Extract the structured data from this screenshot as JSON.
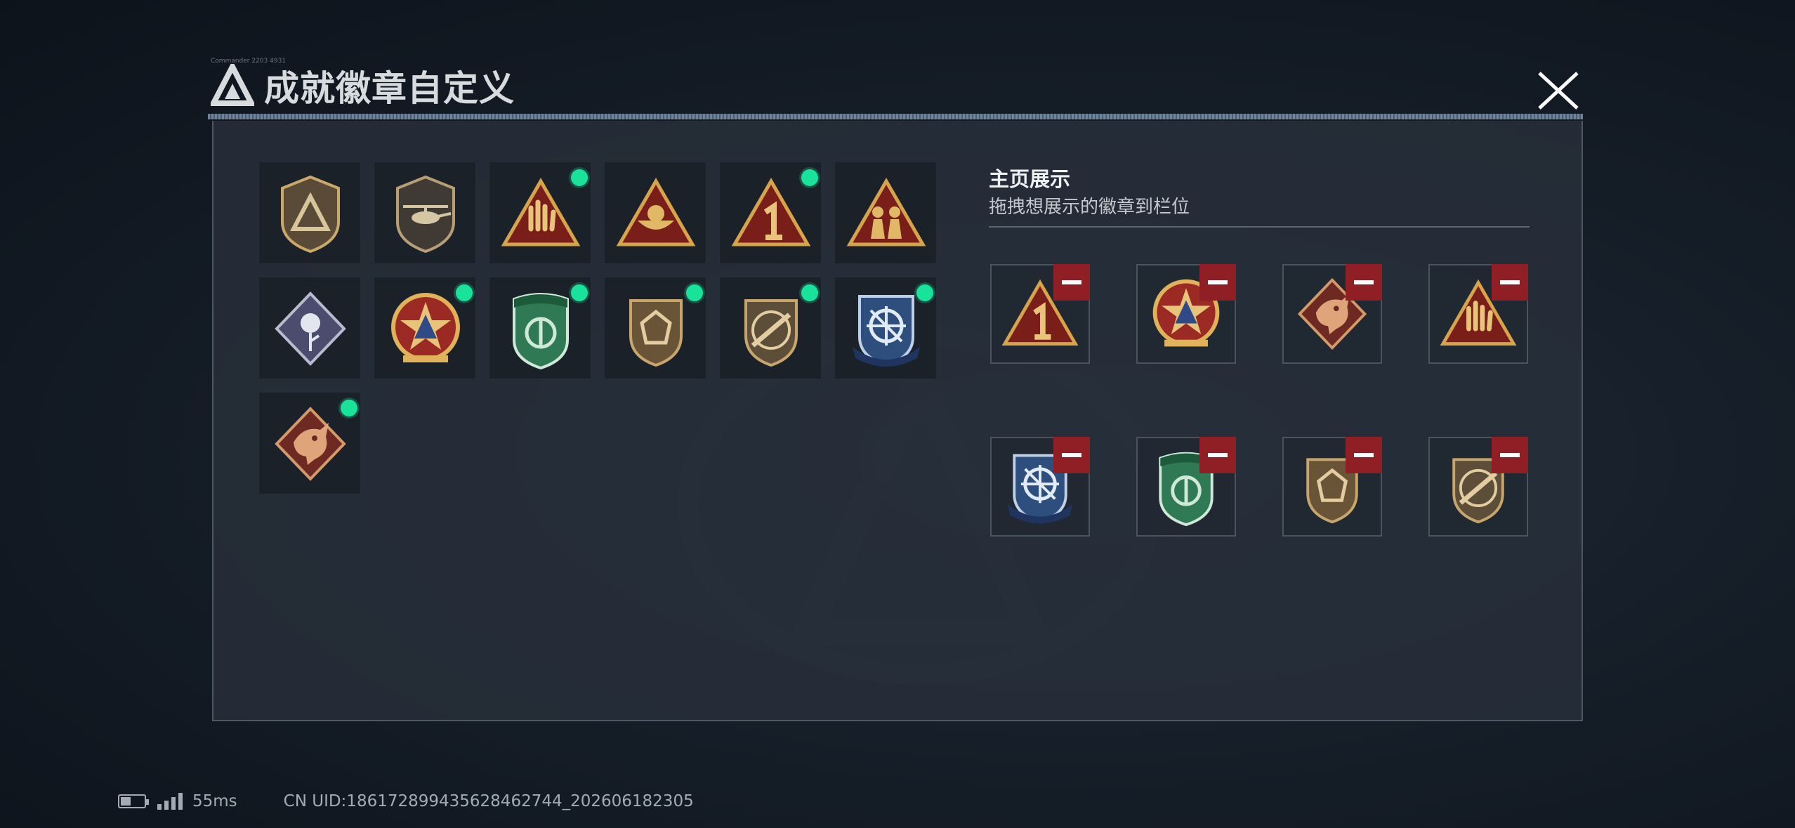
{
  "header": {
    "title": "成就徽章自定义",
    "tiny_text": "Commander 2203 4931"
  },
  "icons": {
    "logo": "triangle-logo-icon",
    "close": "close-icon"
  },
  "colors": {
    "accent_green": "#19e39a",
    "remove_red": "#8f1f25",
    "panel_bg": "#28303a"
  },
  "grid": {
    "badges": [
      {
        "id": "b1",
        "name": "shield-triangle-badge",
        "new": false
      },
      {
        "id": "b2",
        "name": "helicopter-badge",
        "new": false
      },
      {
        "id": "b3",
        "name": "rock-hand-badge",
        "new": true
      },
      {
        "id": "b4",
        "name": "bowl-badge",
        "new": false
      },
      {
        "id": "b5",
        "name": "number-one-badge",
        "new": true
      },
      {
        "id": "b6",
        "name": "soldiers-badge",
        "new": false
      },
      {
        "id": "b7",
        "name": "rose-badge",
        "new": false
      },
      {
        "id": "b8",
        "name": "star-medal-badge",
        "new": true
      },
      {
        "id": "b9",
        "name": "green-shield-badge",
        "new": true
      },
      {
        "id": "b10",
        "name": "gem-shield-badge",
        "new": true
      },
      {
        "id": "b11",
        "name": "rifle-shield-badge",
        "new": true
      },
      {
        "id": "b12",
        "name": "crosshair-crest-badge",
        "new": true
      },
      {
        "id": "b13",
        "name": "dragon-badge",
        "new": true
      }
    ]
  },
  "display": {
    "title": "主页展示",
    "subtitle": "拖拽想展示的徽章到栏位",
    "slots": [
      {
        "badge": "number-one-badge"
      },
      {
        "badge": "star-medal-badge"
      },
      {
        "badge": "dragon-badge"
      },
      {
        "badge": "rock-hand-badge"
      },
      {
        "badge": "crosshair-crest-badge"
      },
      {
        "badge": "green-shield-badge"
      },
      {
        "badge": "gem-shield-badge"
      },
      {
        "badge": "rifle-shield-badge"
      }
    ]
  },
  "footer": {
    "ping": "55ms",
    "uid": "CN UID:18617289943562846274 4_202606182305",
    "uid_text": "CN UID:18617289943562846274​4_202606182305"
  }
}
